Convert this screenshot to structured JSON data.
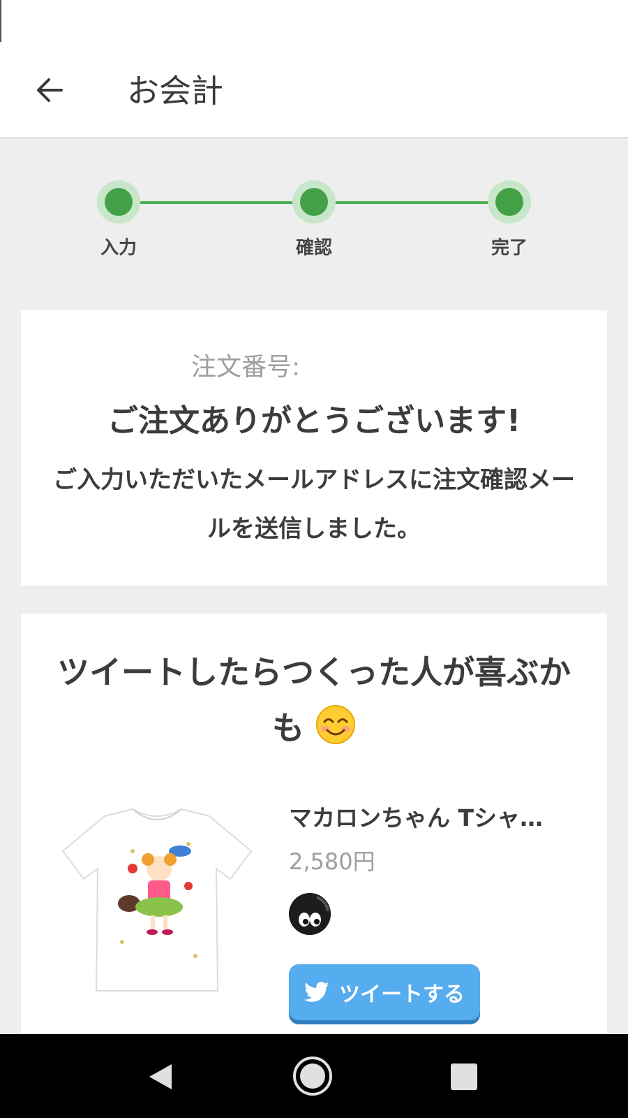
{
  "app_bar": {
    "title": "お会計"
  },
  "stepper": {
    "steps": [
      {
        "label": "入力"
      },
      {
        "label": "確認"
      },
      {
        "label": "完了"
      }
    ],
    "color": "#4caf50"
  },
  "order": {
    "number_label": "注文番号:",
    "thanks": "ご注文ありがとうございます!",
    "mail_note": "ご入力いただいたメールアドレスに注文確認メールを送信しました。"
  },
  "tweet_section": {
    "heading": "ツイートしたらつくった人が喜ぶかも",
    "emoji": "smiling-face-icon",
    "product": {
      "name": "マカロンちゃん Tシャ…",
      "price": "2,580円"
    },
    "tweet_button": "ツイートする",
    "button_color": "#55acee"
  }
}
